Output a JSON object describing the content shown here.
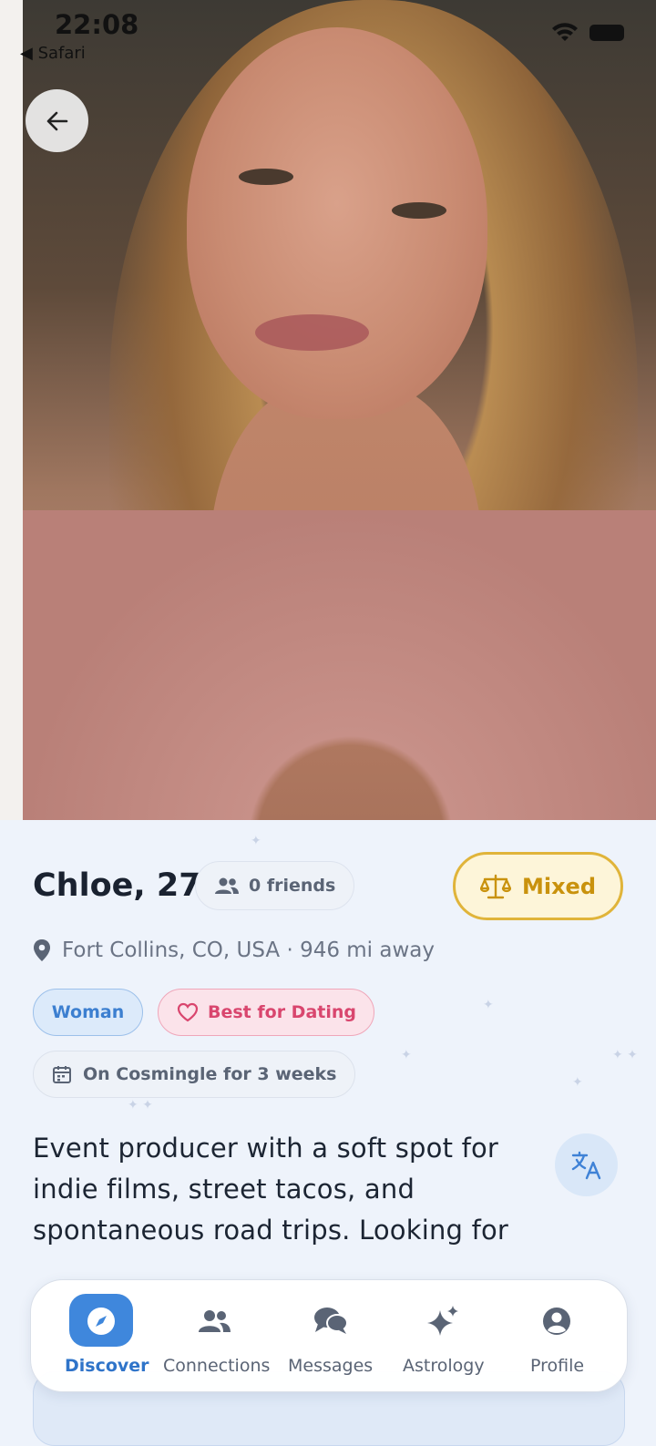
{
  "status_bar": {
    "time": "22:08",
    "back_app": "Safari"
  },
  "profile": {
    "name_age": "Chloe, 27",
    "friends": "0 friends",
    "compatibility": "Mixed",
    "location": "Fort Collins, CO, USA · 946 mi away",
    "tags": {
      "gender": "Woman",
      "intent": "Best for Dating",
      "membership": "On Cosmingle for 3 weeks"
    },
    "bio": "Event producer with a soft spot for indie films, street tacos, and spontaneous road trips. Looking for chemistry, laughter, and a"
  },
  "nav": {
    "items": [
      {
        "label": "Discover",
        "icon": "compass-icon",
        "active": true
      },
      {
        "label": "Connections",
        "icon": "people-icon",
        "active": false
      },
      {
        "label": "Messages",
        "icon": "chat-bubbles-icon",
        "active": false
      },
      {
        "label": "Astrology",
        "icon": "sparkles-icon",
        "active": false
      },
      {
        "label": "Profile",
        "icon": "user-circle-icon",
        "active": false
      }
    ]
  },
  "colors": {
    "accent": "#3f87dc",
    "mixed_gold": "#e0b43a",
    "dating_pink": "#d9466e",
    "background": "#eef3fb"
  }
}
